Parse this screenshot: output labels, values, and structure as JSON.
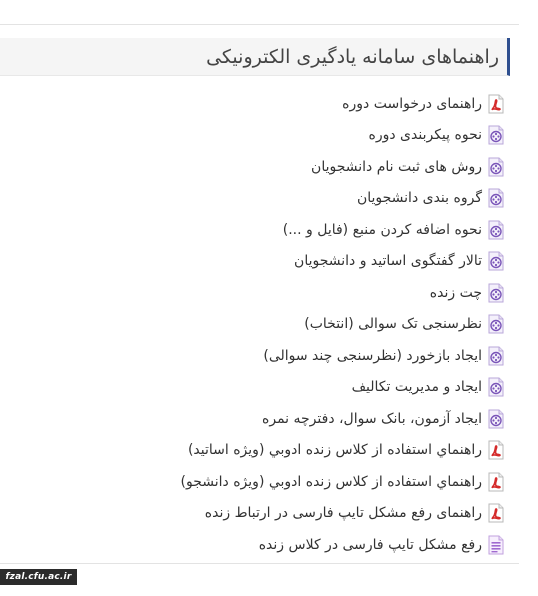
{
  "panel": {
    "title": "راهنماهای سامانه یادگیری الکترونیکی"
  },
  "items": [
    {
      "label": "راهنمای درخواست دوره",
      "icon": "pdf-icon"
    },
    {
      "label": "نحوه پیکربندی دوره",
      "icon": "video-icon"
    },
    {
      "label": "روش های ثبت نام دانشجویان",
      "icon": "video-icon"
    },
    {
      "label": "گروه بندی دانشجویان",
      "icon": "video-icon"
    },
    {
      "label": "نحوه اضافه کردن منبع (فایل و ...)",
      "icon": "video-icon"
    },
    {
      "label": "تالار گفتگوی اساتید و دانشجویان",
      "icon": "video-icon"
    },
    {
      "label": "چت زنده",
      "icon": "video-icon"
    },
    {
      "label": "نظرسنجی تک سوالی (انتخاب)",
      "icon": "video-icon"
    },
    {
      "label": "ایجاد بازخورد (نظرسنجی چند سوالی)",
      "icon": "video-icon"
    },
    {
      "label": "ایجاد و مدیریت تکالیف",
      "icon": "video-icon"
    },
    {
      "label": "ایجاد آزمون، بانک سوال، دفترچه نمره",
      "icon": "video-icon"
    },
    {
      "label": "راهنماي استفاده از كلاس زنده ادوبي (ويژه اساتيد)",
      "icon": "pdf-icon"
    },
    {
      "label": "راهنماي استفاده از كلاس زنده ادوبي (ويژه دانشجو)",
      "icon": "pdf-icon"
    },
    {
      "label": "راهنمای رفع مشکل تایپ فارسی در ارتباط زنده",
      "icon": "pdf-icon"
    },
    {
      "label": "رفع مشکل تایپ فارسی در کلاس زنده",
      "icon": "document-icon"
    }
  ],
  "footer": {
    "badge": "fzal.cfu.ac.ir"
  },
  "colors": {
    "accent_border": "#2f4f8f",
    "pdf_red": "#d42a2a",
    "video_purple": "#7a55b8",
    "doc_purple": "#a06ad0"
  }
}
